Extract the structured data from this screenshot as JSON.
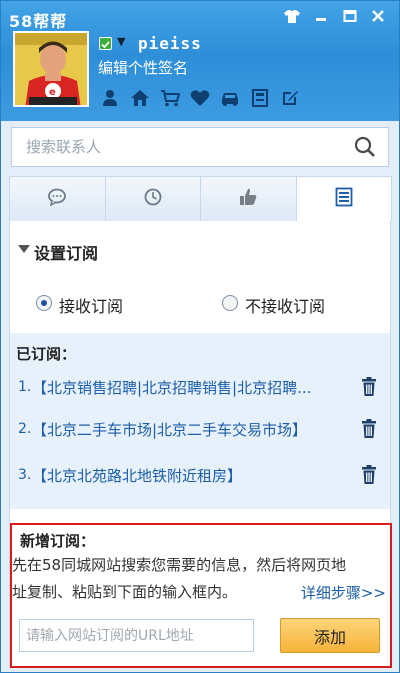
{
  "app": {
    "title": "58帮帮"
  },
  "window_controls": {
    "skin_icon": "shirt-icon",
    "minimize_icon": "minimize-icon",
    "maximize_icon": "maximize-icon",
    "close_icon": "close-icon"
  },
  "profile": {
    "username": "pieiss",
    "signature": "编辑个性签名",
    "status_color": "#3bb13b",
    "tool_icons": [
      "person-icon",
      "home-icon",
      "cart-icon",
      "heart-icon",
      "car-icon",
      "book-icon",
      "edit-icon"
    ]
  },
  "search": {
    "placeholder": "搜索联系人"
  },
  "tabs": [
    {
      "name": "chat-bubble-icon",
      "active": false
    },
    {
      "name": "clock-icon",
      "active": false
    },
    {
      "name": "thumbs-up-icon",
      "active": false
    },
    {
      "name": "list-icon",
      "active": true
    }
  ],
  "settings": {
    "title": "设置订阅",
    "receive_label": "接收订阅",
    "not_receive_label": "不接收订阅",
    "selected": "receive"
  },
  "subscriptions": {
    "title": "已订阅：",
    "items": [
      {
        "num": "1.",
        "text": "【北京销售招聘|北京招聘销售|北京招聘..."
      },
      {
        "num": "2.",
        "text": "【北京二手车市场|北京二手车交易市场】"
      },
      {
        "num": "3.",
        "text": "【北京北苑路北地铁附近租房】"
      }
    ]
  },
  "add": {
    "title": "新增订阅：",
    "desc_line1": "先在58同城网站搜索您需要的信息，然后将网页地",
    "desc_line2": "址复制、粘贴到下面的输入框内。",
    "detail_link": "详细步骤>>",
    "url_placeholder": "请输入网站订阅的URL地址",
    "button_label": "添加"
  },
  "colors": {
    "header": "#2e8ed8",
    "link": "#1c5ea8",
    "highlight_border": "#d51b1b",
    "add_button": "#f6b43a"
  }
}
